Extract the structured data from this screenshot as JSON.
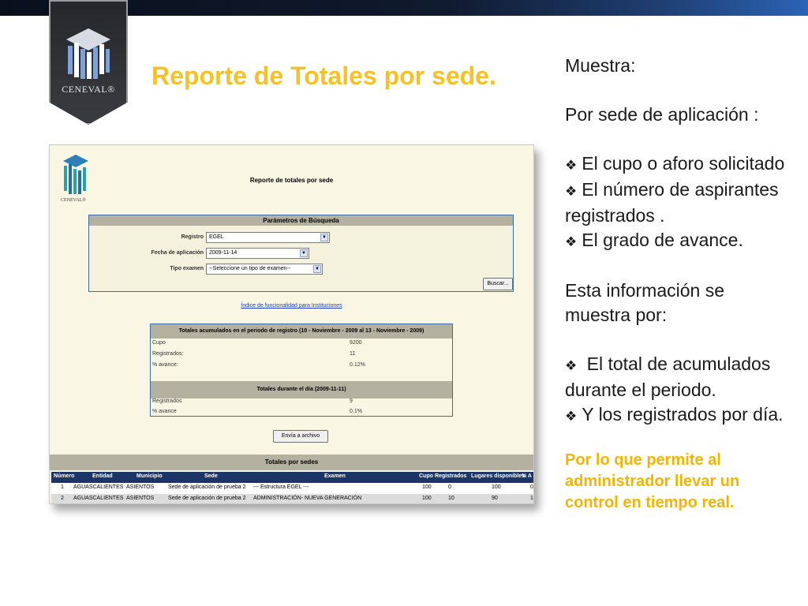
{
  "slide": {
    "title": "Reporte de Totales por sede.",
    "logo_text": "CENEVAL®",
    "colors": {
      "title": "#f5c12b",
      "orange_note": "#f5b400",
      "topbar": "#101a2e"
    }
  },
  "right_panel": {
    "muestra": "Muestra:",
    "por_sede": "Por sede de aplicación :",
    "bullets_a": [
      "El cupo o aforo solicitado",
      "El número de aspirantes registrados .",
      "El grado de avance."
    ],
    "esta_info": "Esta información se muestra por:",
    "bullets_b": [
      " El total de acumulados durante el periodo.",
      "Y los registrados por día."
    ],
    "note": "Por lo que permite al administrador llevar un control  en tiempo real.",
    "bullet_icon": "❖"
  },
  "screenshot": {
    "logo_text": "CENEVAL®",
    "report_title": "Reporte de totales por sede",
    "params": {
      "header": "Parámetros de Búsqueda",
      "registro_label": "Registro",
      "registro_value": "EGEL",
      "fecha_label": "Fecha de aplicación",
      "fecha_value": "2009-11-14",
      "tipo_label": "Tipo examen",
      "tipo_value": "--Seleccione un tipo de examen--",
      "buscar": "Buscar..."
    },
    "index_link": "Índice de funcionalidad para Instituciones",
    "totals": {
      "header": "Totales acumulados en el periodo de registro (10 - Noviembre - 2009 al 13 - Noviembre - 2009)",
      "rows": [
        {
          "label": "Cupo",
          "value": "9200"
        },
        {
          "label": "Registrados:",
          "value": "11"
        },
        {
          "label": "% avance:",
          "value": "0.12%"
        }
      ],
      "day_header": "Totales durante el día (2009-11-11)",
      "day_rows": [
        {
          "label": "Registrados",
          "value": "9"
        },
        {
          "label": "% avance",
          "value": "0.1%"
        }
      ]
    },
    "export_button": "Envía a archivo",
    "sedes_header": "Totales por sedes",
    "table": {
      "columns": [
        "Número",
        "Entidad",
        "Municipio",
        "Sede",
        "Examen",
        "Cupo",
        "Registrados",
        "Lugares disponibles",
        "% A"
      ],
      "rows": [
        [
          "1",
          "AGUASCALIENTES",
          "ASIENTOS",
          "Sede de aplicación de prueba 2",
          "--- Estructura EGEL ---",
          "100",
          "0",
          "100",
          "0"
        ],
        [
          "2",
          "AGUASCALIENTES",
          "ASIENTOS",
          "Sede de aplicación de prueba 2",
          "ADMINISTRACIÓN- NUEVA GENERACIÓN",
          "100",
          "10",
          "90",
          "1"
        ]
      ]
    }
  }
}
